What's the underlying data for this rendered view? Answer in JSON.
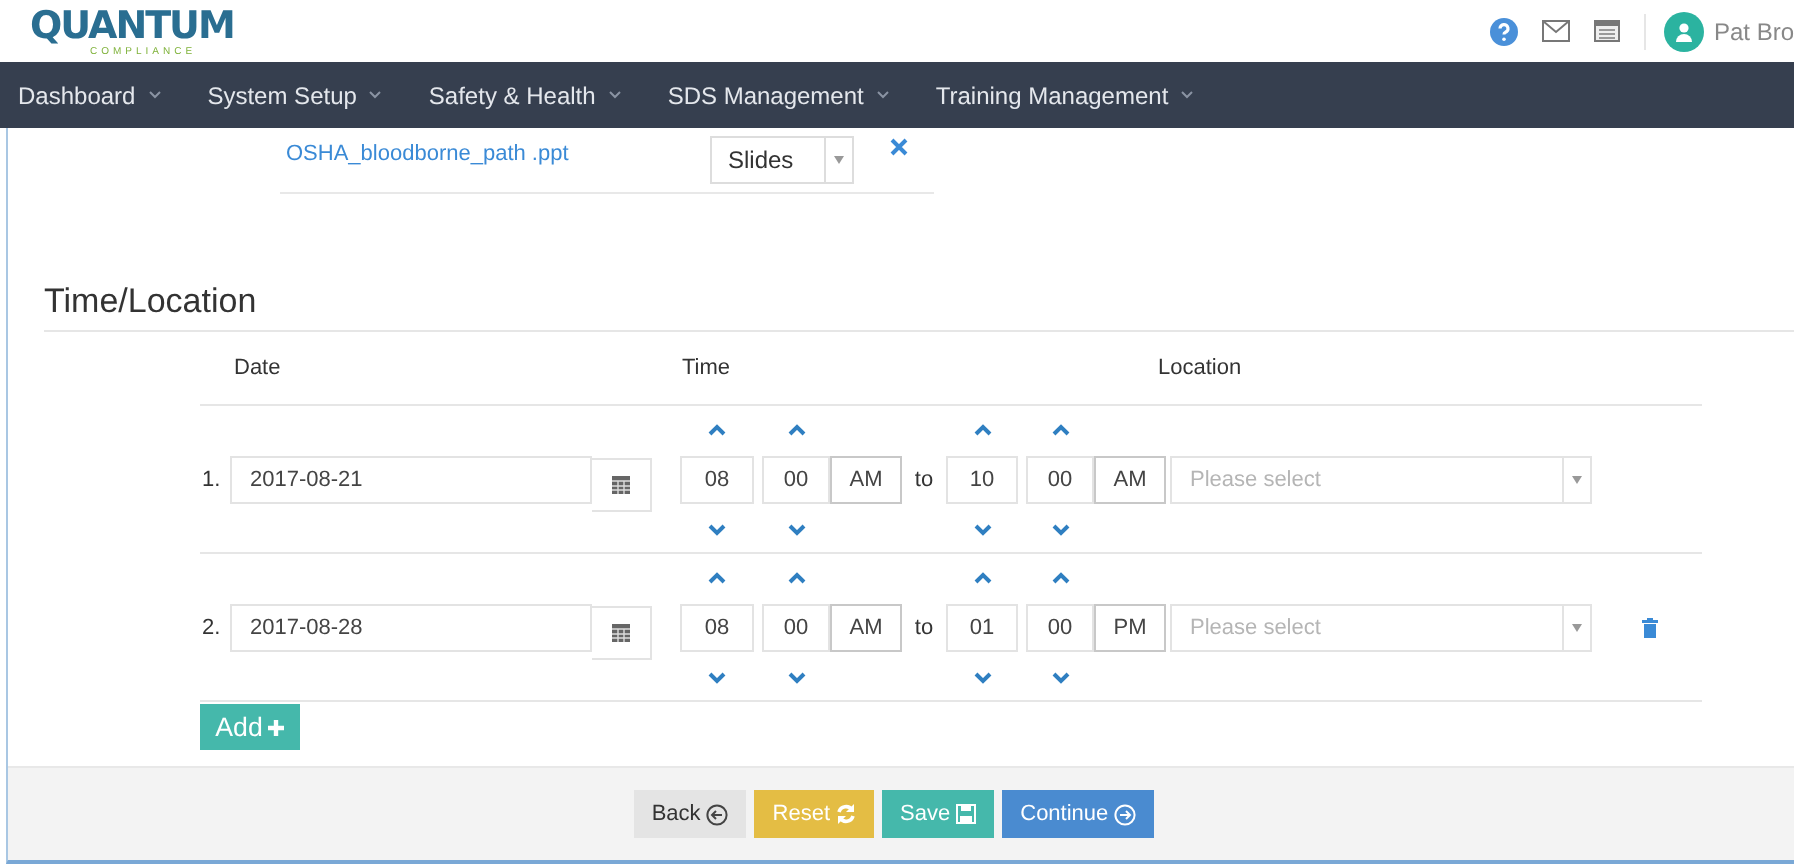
{
  "header": {
    "logo": "QUANTUM",
    "logo_sub": "COMPLIANCE",
    "user_name": "Pat Bro"
  },
  "nav": [
    {
      "label": "Dashboard"
    },
    {
      "label": "System Setup"
    },
    {
      "label": "Safety & Health"
    },
    {
      "label": "SDS Management"
    },
    {
      "label": "Training Management"
    }
  ],
  "attachment": {
    "file": "OSHA_bloodborne_path .ppt",
    "type": "Slides"
  },
  "section_title": "Time/Location",
  "columns": {
    "date": "Date",
    "time": "Time",
    "location": "Location"
  },
  "rows": [
    {
      "number": "1.",
      "date": "2017-08-21",
      "start_hour": "08",
      "start_minute": "00",
      "start_period": "AM",
      "to": "to",
      "end_hour": "10",
      "end_minute": "00",
      "end_period": "AM",
      "location_placeholder": "Please select",
      "deletable": false
    },
    {
      "number": "2.",
      "date": "2017-08-28",
      "start_hour": "08",
      "start_minute": "00",
      "start_period": "AM",
      "to": "to",
      "end_hour": "01",
      "end_minute": "00",
      "end_period": "PM",
      "location_placeholder": "Please select",
      "deletable": true
    }
  ],
  "add_button": "Add",
  "footer_buttons": [
    {
      "label": "Back",
      "kind": "back"
    },
    {
      "label": "Reset",
      "kind": "reset"
    },
    {
      "label": "Save",
      "kind": "save"
    },
    {
      "label": "Continue",
      "kind": "continue"
    }
  ]
}
